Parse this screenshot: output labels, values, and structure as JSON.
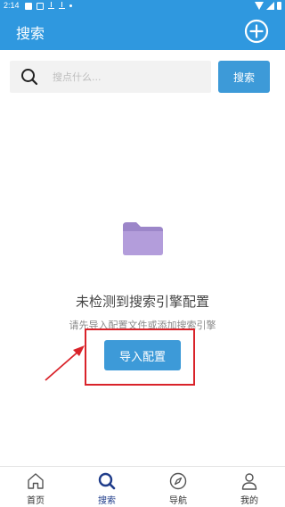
{
  "status_bar": {
    "time": "2:14"
  },
  "app_bar": {
    "title": "搜索",
    "add_icon": "plus-circle-icon"
  },
  "search": {
    "placeholder": "搜点什么...",
    "value": "",
    "button_label": "搜索"
  },
  "empty_state": {
    "icon": "folder-icon",
    "title": "未检测到搜索引擎配置",
    "subtitle": "请先导入配置文件或添加搜索引擎",
    "button_label": "导入配置"
  },
  "bottom_nav": {
    "items": [
      {
        "label": "首页",
        "icon": "home-icon",
        "active": false
      },
      {
        "label": "搜索",
        "icon": "search-icon",
        "active": true
      },
      {
        "label": "导航",
        "icon": "compass-icon",
        "active": false
      },
      {
        "label": "我的",
        "icon": "user-icon",
        "active": false
      }
    ]
  },
  "colors": {
    "primary": "#2f98df",
    "button": "#3d9ad8",
    "folder": "#b39ddb",
    "annotation": "#d9232a",
    "nav_active": "#1f3c8a"
  }
}
